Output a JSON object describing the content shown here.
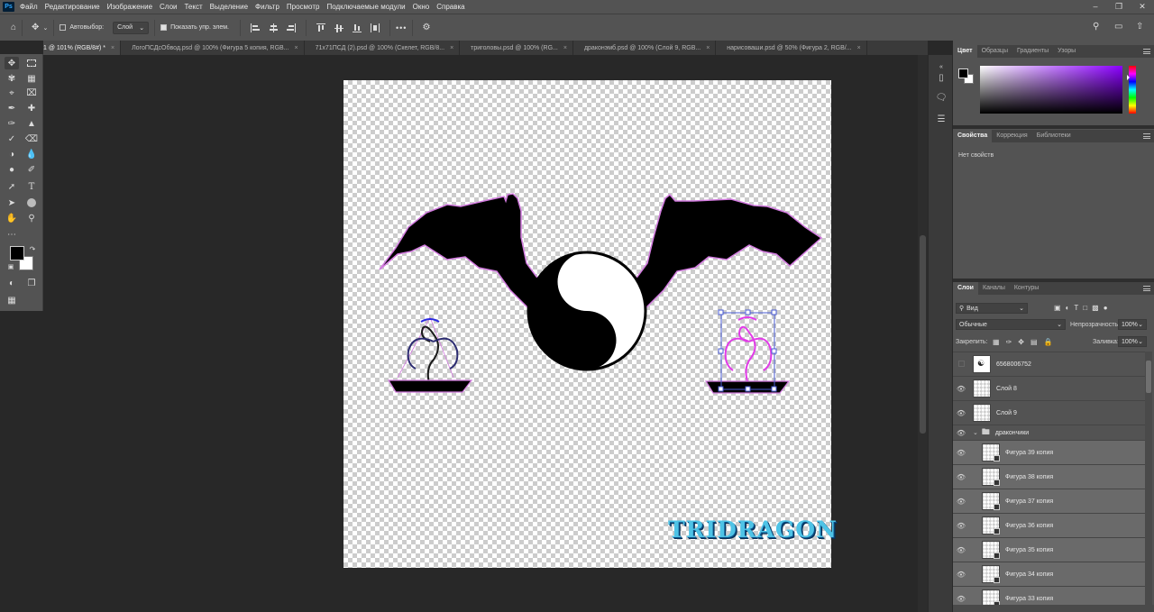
{
  "menu": {
    "logo": "Ps",
    "items": [
      "Файл",
      "Редактирование",
      "Изображение",
      "Слои",
      "Текст",
      "Выделение",
      "Фильтр",
      "Просмотр",
      "Подключаемые модули",
      "Окно",
      "Справка"
    ]
  },
  "options": {
    "autoselect_label": "Автовыбор:",
    "autoselect_value": "Слой",
    "show_controls_label": "Показать упр. элем.",
    "more": "•••"
  },
  "tabs": [
    {
      "label": "1 @ 101% (RGB/8#) *",
      "active": true
    },
    {
      "label": "ЛогоПСДсОбвод.psd @ 100% (Фигура 5 копия, RGB...",
      "active": false
    },
    {
      "label": "71х71ПСД (2).psd @ 100% (Скелет, RGB/8...",
      "active": false
    },
    {
      "label": "триголовы.psd @ 100% (RG...",
      "active": false
    },
    {
      "label": "драконэмб.psd @ 100% (Слой 9, RGB...",
      "active": false
    },
    {
      "label": "нарисоваши.psd @ 50% (Фигура 2, RGB/...",
      "active": false
    }
  ],
  "tab_close": "×",
  "canvas": {
    "logo_text": "TRIDRAGON"
  },
  "panels": {
    "color_tabs": [
      "Цвет",
      "Образцы",
      "Градиенты",
      "Узоры"
    ],
    "props_tabs": [
      "Свойства",
      "Коррекция",
      "Библиотеки"
    ],
    "props_empty": "Нет свойств",
    "layer_tabs": [
      "Слои",
      "Каналы",
      "Контуры"
    ],
    "filter_kind": "Вид",
    "blend_mode": "Обычные",
    "opacity_label": "Непрозрачность:",
    "opacity_value": "100%",
    "lock_label": "Закрепить:",
    "fill_label": "Заливка:",
    "fill_value": "100%"
  },
  "layers": [
    {
      "name": "6568006752",
      "visible": false,
      "type": "image",
      "selected": false
    },
    {
      "name": "Слой 8",
      "visible": true,
      "type": "layer",
      "selected": false
    },
    {
      "name": "Слой 9",
      "visible": true,
      "type": "layer",
      "selected": false
    },
    {
      "name": "дракончики",
      "visible": true,
      "type": "group",
      "selected": false
    },
    {
      "name": "Фигура 39 копия",
      "visible": true,
      "type": "smart",
      "selected": true
    },
    {
      "name": "Фигура 38 копия",
      "visible": true,
      "type": "smart",
      "selected": true
    },
    {
      "name": "Фигура 37 копия",
      "visible": true,
      "type": "smart",
      "selected": true
    },
    {
      "name": "Фигура 36 копия",
      "visible": true,
      "type": "smart",
      "selected": true
    },
    {
      "name": "Фигура 35 копия",
      "visible": true,
      "type": "smart",
      "selected": true
    },
    {
      "name": "Фигура 34 копия",
      "visible": true,
      "type": "smart",
      "selected": true
    },
    {
      "name": "Фигура 33 копия",
      "visible": true,
      "type": "smart",
      "selected": true
    }
  ],
  "colors": {
    "foreground": "#000000",
    "background": "#ffffff",
    "picker_hue": "#8b00ff",
    "logo_fill": "#4ec3e6"
  }
}
